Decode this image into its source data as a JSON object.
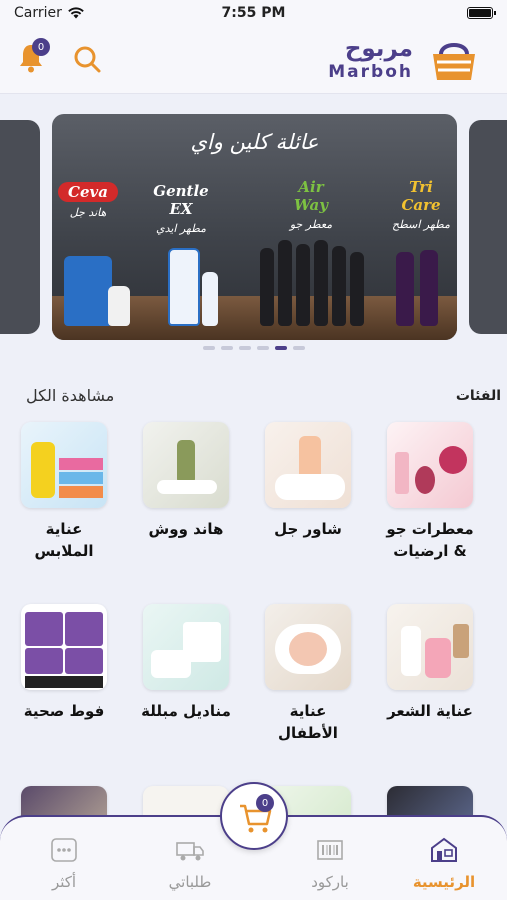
{
  "status_bar": {
    "carrier": "Carrier",
    "time": "7:55 PM"
  },
  "header": {
    "notification_count": "0",
    "logo_ar": "مربوح",
    "logo_en": "Marboh"
  },
  "banner": {
    "headline": "عائلة كلين واي",
    "brands": [
      {
        "name": "Ceva",
        "sub": "هاند جل"
      },
      {
        "name": "Gentle EX",
        "sub": "مطهر ايدي"
      },
      {
        "name": "Air Way",
        "sub": "معطر جو"
      },
      {
        "name": "Tri Care",
        "sub": "مطهر اسطح"
      }
    ],
    "slide_count": 6,
    "active_slide_index": 4
  },
  "categories_section": {
    "title": "الفئات",
    "see_all": "مشاهدة الكل"
  },
  "categories": [
    {
      "label": "معطرات جو & ارضيات"
    },
    {
      "label": "شاور جل"
    },
    {
      "label": "هاند ووش"
    },
    {
      "label": "عناية الملابس"
    },
    {
      "label": "عناية الشعر"
    },
    {
      "label": "عناية الأطفال"
    },
    {
      "label": "مناديل مبللة"
    },
    {
      "label": "فوط صحية"
    }
  ],
  "bottom_nav": {
    "home": "الرئيسية",
    "barcode": "باركود",
    "orders": "طلباتي",
    "more": "أكثر",
    "cart_count": "0"
  },
  "colors": {
    "brand": "#4c3f8a",
    "accent": "#e8932e"
  }
}
